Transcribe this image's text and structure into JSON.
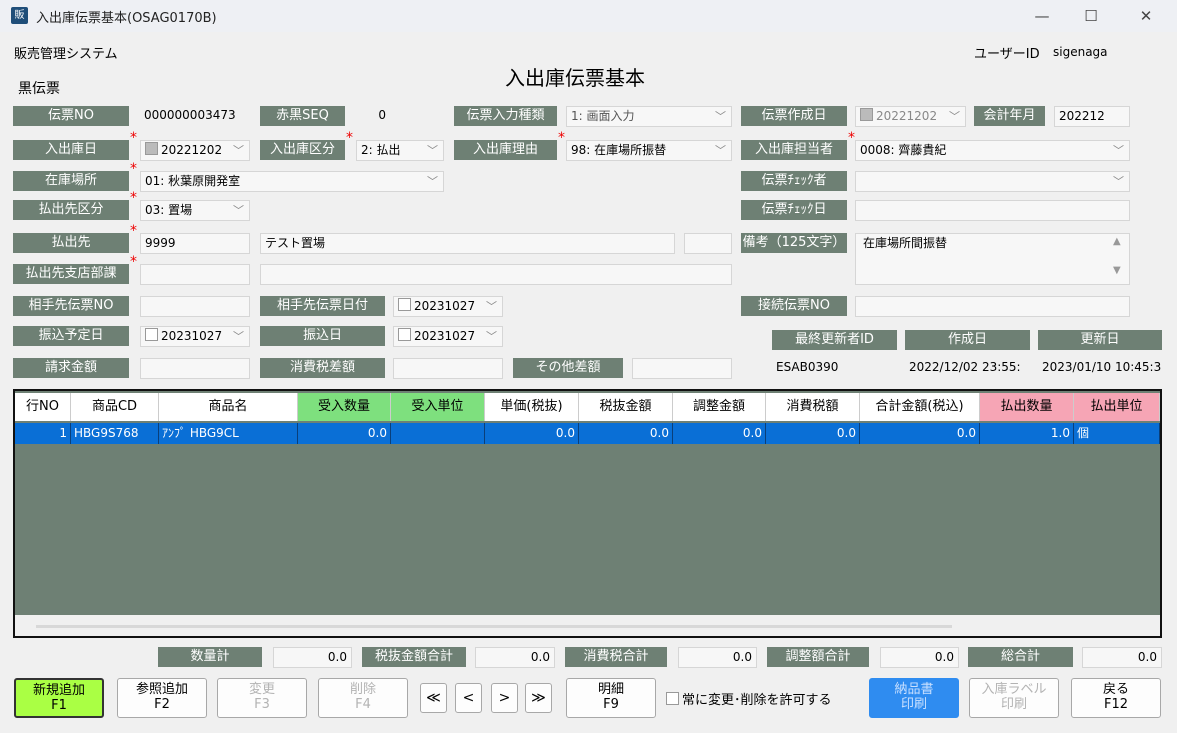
{
  "window": {
    "icon": "販",
    "title": "入出庫伝票基本(OSAG0170B)"
  },
  "header": {
    "system_name": "販売管理システム",
    "user_label": "ユーザーID",
    "user_id": "sigenaga",
    "page_title": "入出庫伝票基本",
    "slip_type": "黒伝票"
  },
  "form": {
    "slip_no": {
      "label": "伝票NO",
      "value": "000000003473"
    },
    "red_black_seq": {
      "label": "赤黒SEQ",
      "value": "0"
    },
    "input_type": {
      "label": "伝票入力種類",
      "value": "1: 画面入力"
    },
    "created_date": {
      "label": "伝票作成日",
      "value": "20221202"
    },
    "account_month": {
      "label": "会計年月",
      "value": "202212"
    },
    "io_date": {
      "label": "入出庫日",
      "value": "20221202"
    },
    "io_class": {
      "label": "入出庫区分",
      "value": "2: 払出"
    },
    "io_reason": {
      "label": "入出庫理由",
      "value": "98: 在庫場所振替"
    },
    "io_staff": {
      "label": "入出庫担当者",
      "value": "0008: 齊藤貴紀"
    },
    "stock_location": {
      "label": "在庫場所",
      "value": "01: 秋葉原開発室"
    },
    "slip_checker": {
      "label": "伝票ﾁｪｯｸ者",
      "value": ""
    },
    "dest_class": {
      "label": "払出先区分",
      "value": "03: 置場"
    },
    "slip_check_date": {
      "label": "伝票ﾁｪｯｸ日",
      "value": ""
    },
    "dest": {
      "label": "払出先",
      "code": "9999",
      "name": "テスト置場"
    },
    "note": {
      "label": "備考（125文字）",
      "value": "在庫場所間振替"
    },
    "dest_branch": {
      "label": "払出先支店部課"
    },
    "partner_slip_no": {
      "label": "相手先伝票NO",
      "value": ""
    },
    "partner_slip_date": {
      "label": "相手先伝票日付",
      "value": "20231027"
    },
    "link_slip_no": {
      "label": "接続伝票NO",
      "value": ""
    },
    "transfer_plan_date": {
      "label": "振込予定日",
      "value": "20231027"
    },
    "transfer_date": {
      "label": "振込日",
      "value": "20231027"
    },
    "last_updater": {
      "label": "最終更新者ID",
      "value": "ESAB0390"
    },
    "created": {
      "label": "作成日",
      "value": "2022/12/02 23:55:"
    },
    "updated": {
      "label": "更新日",
      "value": "2023/01/10 10:45:3"
    },
    "billing_amount": {
      "label": "請求金額",
      "value": ""
    },
    "tax_diff": {
      "label": "消費税差額",
      "value": ""
    },
    "other_diff": {
      "label": "その他差額",
      "value": ""
    }
  },
  "grid": {
    "columns": [
      "行NO",
      "商品CD",
      "商品名",
      "受入数量",
      "受入単位",
      "単価(税抜)",
      "税抜金額",
      "調整金額",
      "消費税額",
      "合計金額(税込)",
      "払出数量",
      "払出単位"
    ],
    "rows": [
      [
        "1",
        "HBG9S768",
        "ｱﾝﾌﾟ  HBG9CL",
        "0.0",
        "",
        "0.0",
        "0.0",
        "0.0",
        "0.0",
        "0.0",
        "1.0",
        "個"
      ]
    ]
  },
  "totals": {
    "qty": {
      "label": "数量計",
      "value": "0.0"
    },
    "excl_tax": {
      "label": "税抜金額合計",
      "value": "0.0"
    },
    "tax": {
      "label": "消費税合計",
      "value": "0.0"
    },
    "adjust": {
      "label": "調整額合計",
      "value": "0.0"
    },
    "grand": {
      "label": "総合計",
      "value": "0.0"
    }
  },
  "buttons": {
    "new_add": {
      "l1": "新規追加",
      "l2": "F1"
    },
    "ref_add": {
      "l1": "参照追加",
      "l2": "F2"
    },
    "change": {
      "l1": "変更",
      "l2": "F3"
    },
    "delete": {
      "l1": "削除",
      "l2": "F4"
    },
    "first": "≪",
    "prev": "<",
    "next": ">",
    "last": "≫",
    "detail": {
      "l1": "明細",
      "l2": "F9"
    },
    "allow_edit": "常に変更･削除を許可する",
    "delivery_print": {
      "l1": "納品書",
      "l2": "印刷"
    },
    "label_print": {
      "l1": "入庫ラベル",
      "l2": "印刷"
    },
    "back": {
      "l1": "戻る",
      "l2": "F12"
    }
  },
  "colors": {
    "label_bg": "#6e8074",
    "selected_row": "#0a6fd6",
    "accent_green": "#aaff44",
    "accent_blue": "#2f8cf0"
  }
}
